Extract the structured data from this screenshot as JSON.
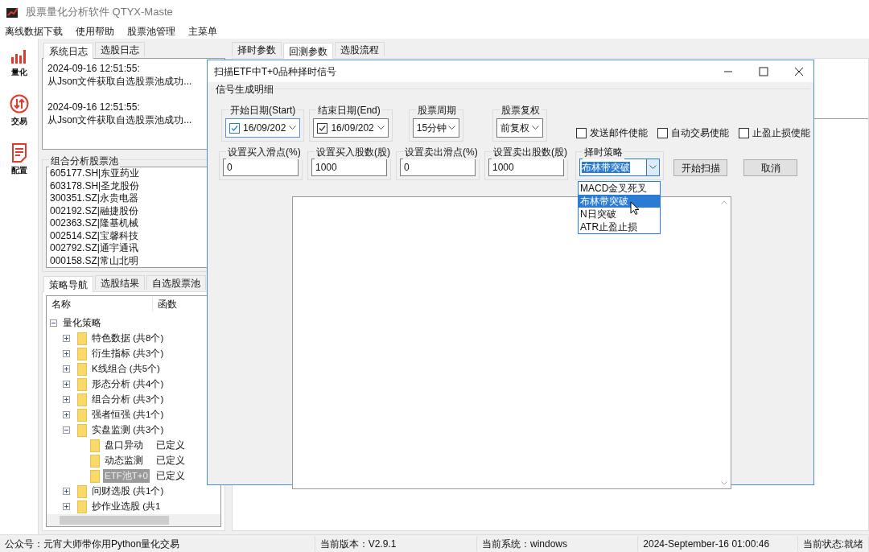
{
  "window": {
    "title": "股票量化分析软件 QTYX-Maste"
  },
  "menu": [
    "离线数据下载",
    "使用帮助",
    "股票池管理",
    "主菜单"
  ],
  "nav": [
    {
      "kind": "chart",
      "label": "量化"
    },
    {
      "kind": "trade",
      "label": "交易"
    },
    {
      "kind": "config",
      "label": "配置"
    }
  ],
  "log_tabs": [
    {
      "label": "系统日志",
      "selected": true
    },
    {
      "label": "选股日志",
      "selected": false
    }
  ],
  "log": [
    {
      "time": "2024-09-16 12:51:55:",
      "message": "从Json文件获取自选股票池成功..."
    },
    {
      "time": "2024-09-16 12:51:55:",
      "message": "从Json文件获取自选股票池成功..."
    }
  ],
  "pool": {
    "title": "组合分析股票池",
    "items": [
      "605177.SH|东亚药业",
      "603178.SH|圣龙股份",
      "300351.SZ|永贵电器",
      "002192.SZ|融捷股份",
      "002363.SZ|隆基机械",
      "002514.SZ|宝馨科技",
      "002792.SZ|通宇通讯",
      "000158.SZ|常山北明"
    ]
  },
  "strategy_tabs": [
    {
      "label": "策略导航",
      "selected": true
    },
    {
      "label": "选股结果",
      "selected": false
    },
    {
      "label": "自选股票池",
      "selected": false
    }
  ],
  "tree": {
    "columns": [
      "名称",
      "函数"
    ],
    "nodes": [
      {
        "label": "量化策略",
        "expanded": true,
        "selected": false,
        "children": [
          {
            "label": "特色数据 (共8个)",
            "expanded": false,
            "selected": false
          },
          {
            "label": "衍生指标 (共3个)",
            "expanded": false,
            "selected": false
          },
          {
            "label": "K线组合 (共5个)",
            "expanded": false,
            "selected": false
          },
          {
            "label": "形态分析 (共4个)",
            "expanded": false,
            "selected": false
          },
          {
            "label": "组合分析 (共3个)",
            "expanded": false,
            "selected": false
          },
          {
            "label": "强者恒强 (共1个)",
            "expanded": false,
            "selected": false
          },
          {
            "label": "实盘监测 (共3个)",
            "expanded": true,
            "selected": false,
            "children": [
              {
                "label": "盘口异动",
                "func": "已定义",
                "selected": false
              },
              {
                "label": "动态监测",
                "func": "已定义",
                "selected": false
              },
              {
                "label": "ETF池T+0",
                "func": "已定义",
                "selected": true
              }
            ]
          },
          {
            "label": "问财选股 (共1个)",
            "expanded": false,
            "selected": false
          },
          {
            "label": "抄作业选股 (共1",
            "expanded": false,
            "selected": false
          }
        ]
      }
    ]
  },
  "main_tabs": [
    {
      "label": "择时参数",
      "selected": false
    },
    {
      "label": "回测参数",
      "selected": true
    },
    {
      "label": "选股流程",
      "selected": false
    }
  ],
  "dialog": {
    "title": "扫描ETF中T+0品种择时信号",
    "group": "信号生成明细",
    "dates": [
      {
        "label": "开始日期(Start)",
        "value": "16/09/202",
        "checked": true,
        "focused": true
      },
      {
        "label": "结束日期(End)",
        "value": "16/09/202",
        "checked": true,
        "focused": false
      }
    ],
    "selects": [
      {
        "label": "股票周期",
        "value": "15分钟"
      },
      {
        "label": "股票复权",
        "value": "前复权"
      }
    ],
    "options": [
      {
        "label": "发送邮件使能",
        "checked": false
      },
      {
        "label": "自动交易使能",
        "checked": false
      },
      {
        "label": "止盈止损使能",
        "checked": false
      }
    ],
    "inputs": [
      {
        "label": "设置买入滑点(%)",
        "value": "0"
      },
      {
        "label": "设置买入股数(股)",
        "value": "1000"
      },
      {
        "label": "设置卖出滑点(%)",
        "value": "0"
      },
      {
        "label": "设置卖出股数(股)",
        "value": "1000"
      }
    ],
    "strategy": {
      "label": "择时策略",
      "value": "布林带突破",
      "open": true,
      "options": [
        {
          "label": "MACD金叉死叉",
          "selected": false
        },
        {
          "label": "布林带突破",
          "selected": true
        },
        {
          "label": "N日突破",
          "selected": false
        },
        {
          "label": "ATR止盈止损",
          "selected": false
        }
      ]
    },
    "buttons": [
      "开始扫描",
      "取消"
    ]
  },
  "status_bar": [
    "公众号：元宵大师带你用Python量化交易",
    "当前版本：V2.9.1",
    "当前系统：windows",
    "2024-September-16 01:00:46",
    "当前状态:就绪"
  ]
}
